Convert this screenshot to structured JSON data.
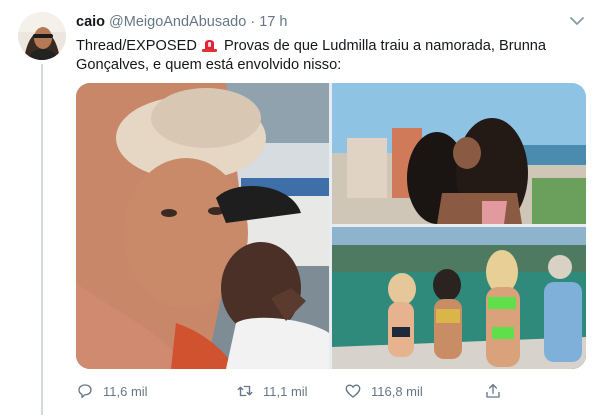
{
  "tweet": {
    "author_name": "caio",
    "author_handle": "@MeigoAndAbusado",
    "separator": "·",
    "time": "17 h",
    "text_before": "Thread/EXPOSED",
    "text_after": " Provas de que Ludmilla traiu a namorada, Brunna Gonçalves, e quem está envolvido nisso:"
  },
  "actions": {
    "reply_count": "11,6 mil",
    "retweet_count": "11,1 mil",
    "like_count": "116,8 mil"
  },
  "icons": {
    "reply": "reply-icon",
    "retweet": "retweet-icon",
    "like": "heart-icon",
    "share": "share-icon",
    "menu": "chevron-down-icon",
    "siren": "police-light-emoji"
  },
  "colors": {
    "text_primary": "#14171a",
    "text_secondary": "#657786",
    "thread_line": "#cfd9de"
  }
}
